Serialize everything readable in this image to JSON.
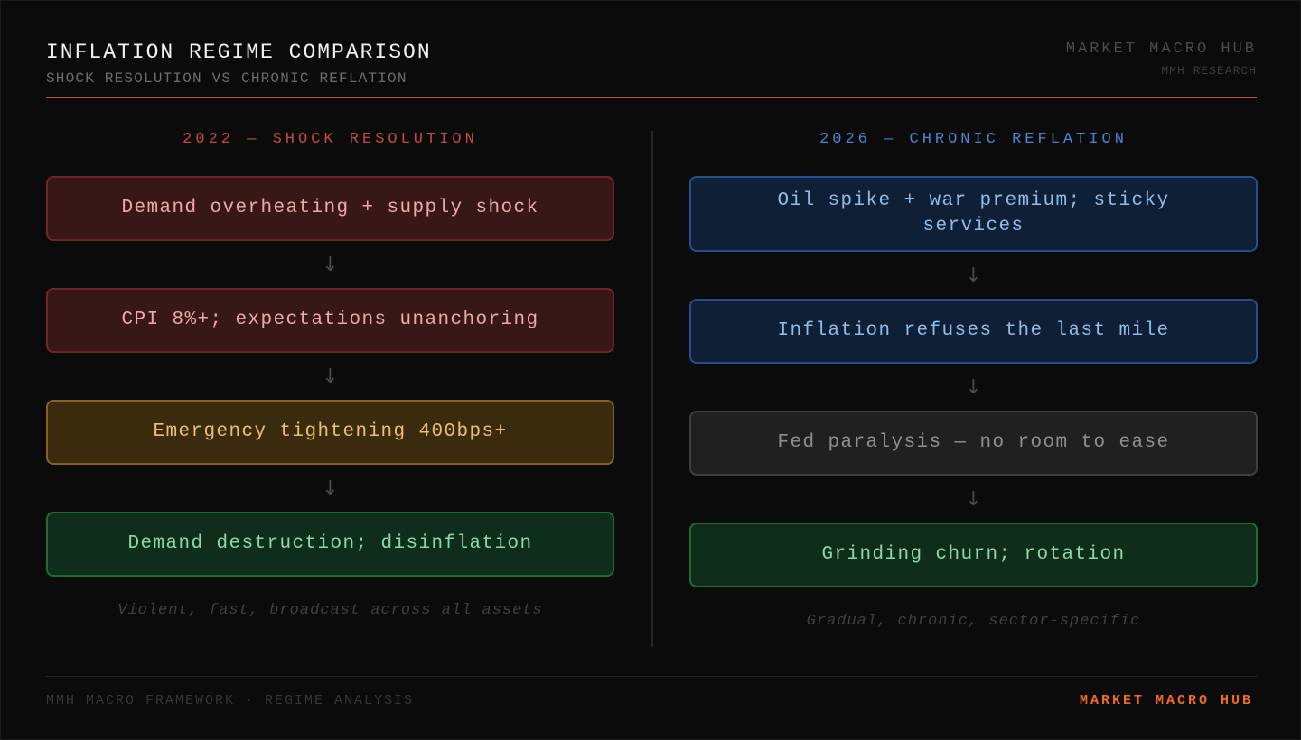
{
  "header": {
    "title": "INFLATION REGIME COMPARISON",
    "subtitle": "SHOCK RESOLUTION VS CHRONIC REFLATION",
    "brand": "MARKET MACRO HUB",
    "brand_sub": "MMH RESEARCH"
  },
  "left": {
    "heading": "2022 — SHOCK RESOLUTION",
    "steps": [
      {
        "label": "Demand overheating + supply shock",
        "tone": "red"
      },
      {
        "label": "CPI 8%+; expectations unanchoring",
        "tone": "red"
      },
      {
        "label": "Emergency tightening 400bps+",
        "tone": "amber"
      },
      {
        "label": "Demand destruction; disinflation",
        "tone": "green"
      }
    ],
    "caption": "Violent, fast, broadcast across all assets"
  },
  "right": {
    "heading": "2026 — CHRONIC REFLATION",
    "steps": [
      {
        "label": "Oil spike + war premium; sticky services",
        "tone": "blue"
      },
      {
        "label": "Inflation refuses the last mile",
        "tone": "blue"
      },
      {
        "label": "Fed paralysis — no room to ease",
        "tone": "gray"
      },
      {
        "label": "Grinding churn; rotation",
        "tone": "green"
      }
    ],
    "caption": "Gradual, chronic, sector-specific"
  },
  "arrow_glyph": "↓",
  "footer": {
    "left": "MMH MACRO FRAMEWORK · REGIME ANALYSIS",
    "right": "MARKET MACRO HUB"
  },
  "colors": {
    "accent": "#f26c1e",
    "red_heading": "#c94a43",
    "blue_heading": "#4a86d4"
  }
}
